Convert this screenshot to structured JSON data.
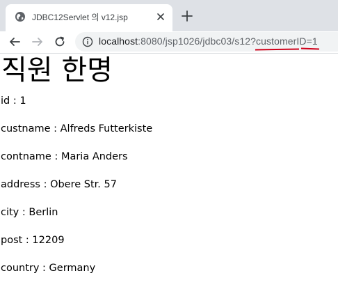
{
  "browser": {
    "tab_title": "JDBC12Servlet 의 v12.jsp",
    "url_host": "localhost",
    "url_rest": ":8080/jsp1026/jdbc03/s12?customerID=1"
  },
  "page": {
    "heading": "직원 한명",
    "fields": [
      "id : 1",
      "custname : Alfreds Futterkiste",
      "contname : Maria Anders",
      "address : Obere Str. 57",
      "city : Berlin",
      "post : 12209",
      "country : Germany"
    ]
  },
  "colors": {
    "annotation_underline": "#d0021b",
    "tabstrip": "#dee1e6",
    "omnibox": "#f1f3f4"
  }
}
